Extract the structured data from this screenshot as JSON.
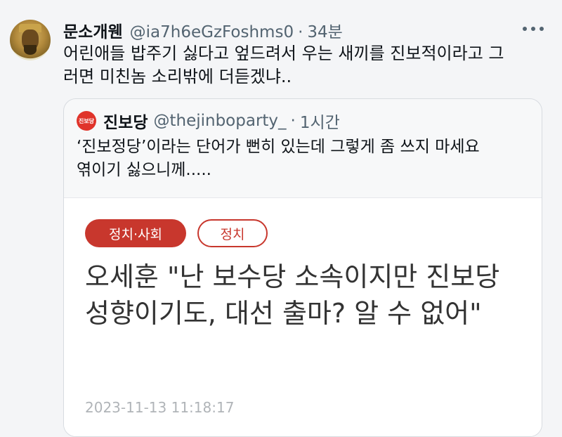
{
  "tweet": {
    "author_name": "문소개웬",
    "handle": "@ia7h6eGzFoshms0",
    "separator": "·",
    "time": "34분",
    "text": "어린애들 밥주기 싫다고 엎드려서 우는 새끼를 진보적이라고 그\n러면 미친놈 소리밖에 더듣겠냐..",
    "more_icon": "more-dots-icon"
  },
  "quote": {
    "logo_text": "진보당",
    "author_name": "진보당",
    "handle": "@thejinboparty_",
    "separator": "·",
    "time": "1시간",
    "text": "‘진보정당’이라는 단어가 뻔히 있는데 그렇게 좀 쓰지 마세요\n엮이기 싫으니께.....",
    "article": {
      "tags": [
        "정치·사회",
        "정치"
      ],
      "headline": "오세훈 \"난 보수당 소속이지만 진보당 성향이기도, 대선 출마? 알 수 없어\"",
      "date": "2023-11-13 11:18:17",
      "accent_color": "#c8372d"
    }
  }
}
